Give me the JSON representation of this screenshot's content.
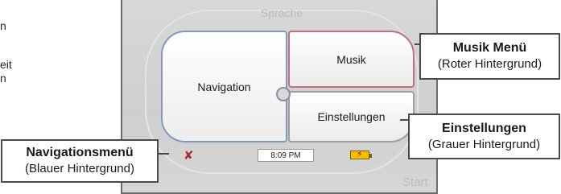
{
  "left_text": [
    "n",
    "eit",
    "n"
  ],
  "screen": {
    "ghost_top": "Sprache",
    "ghost_bottom": "Start",
    "buttons": {
      "navigation": "Navigation",
      "musik": "Musik",
      "einstellungen": "Einstellungen"
    },
    "status": {
      "time": "8:09 PM",
      "gps_icon": "gps-off-icon",
      "battery_icon": "battery-charging-icon"
    }
  },
  "callouts": {
    "musik": {
      "title": "Musik Menü",
      "subtitle": "(Roter Hintergrund)"
    },
    "einstellungen": {
      "title": "Einstellungen",
      "subtitle": "(Grauer Hintergrund)"
    },
    "navigation": {
      "title": "Navigationsmenü",
      "subtitle": "(Blauer Hintergrund)"
    }
  },
  "colors": {
    "navigation_border": "#8597c0",
    "musik_border": "#c0707a",
    "einstellungen_border": "#9e9e9e"
  }
}
